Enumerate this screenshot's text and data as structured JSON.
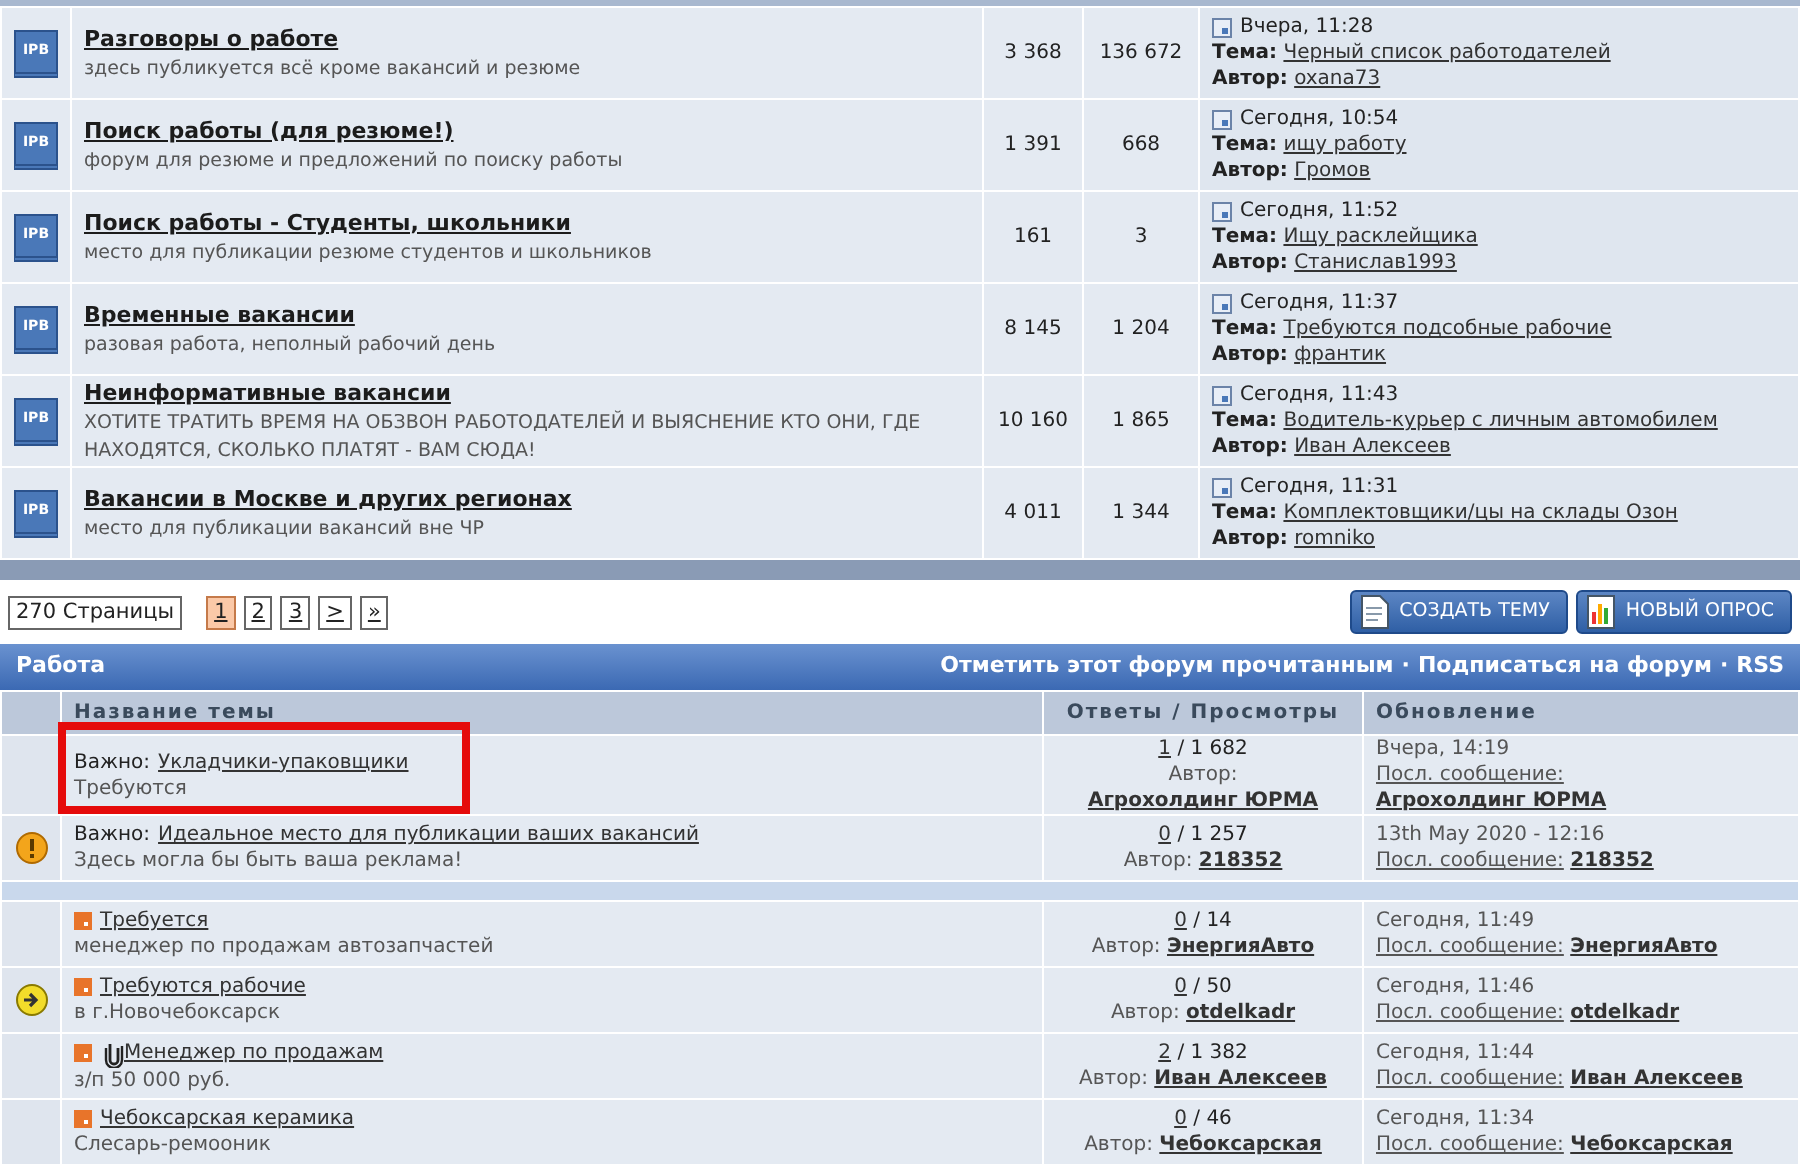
{
  "forums": [
    {
      "icon_text": "IPB",
      "title": "Разговоры о работе",
      "description": "здесь публикуется всё кроме вакансий и резюме",
      "topics": "3 368",
      "posts": "136 672",
      "last_date": "Вчера, 11:28",
      "topic_label": "Тема:",
      "last_topic": "Черный список работодателей",
      "author_label": "Автор:",
      "last_author": "oxana73"
    },
    {
      "icon_text": "IPB",
      "title": "Поиск работы (для резюме!)",
      "description": "форум для резюме и предложений по поиску работы",
      "topics": "1 391",
      "posts": "668",
      "last_date": "Сегодня, 10:54",
      "topic_label": "Тема:",
      "last_topic": "ищу работу",
      "author_label": "Автор:",
      "last_author": "Громов"
    },
    {
      "icon_text": "IPB",
      "title": "Поиск работы - Студенты, школьники",
      "description": "место для публикации резюме студентов и школьников",
      "topics": "161",
      "posts": "3",
      "last_date": "Сегодня, 11:52",
      "topic_label": "Тема:",
      "last_topic": "Ищу расклейщика",
      "author_label": "Автор:",
      "last_author": "Станислав1993"
    },
    {
      "icon_text": "IPB",
      "title": "Временные вакансии",
      "description": "разовая работа, неполный рабочий день",
      "topics": "8 145",
      "posts": "1 204",
      "last_date": "Сегодня, 11:37",
      "topic_label": "Тема:",
      "last_topic": "Требуются подсобные рабочие",
      "author_label": "Автор:",
      "last_author": "франтик"
    },
    {
      "icon_text": "IPB",
      "title": "Неинформативные вакансии",
      "description": "ХОТИТЕ ТРАТИТЬ ВРЕМЯ НА ОБЗВОН РАБОТОДАТЕЛЕЙ И ВЫЯСНЕНИЕ КТО ОНИ, ГДЕ НАХОДЯТСЯ, СКОЛЬКО ПЛАТЯТ - ВАМ СЮДА!",
      "topics": "10 160",
      "posts": "1 865",
      "last_date": "Сегодня, 11:43",
      "topic_label": "Тема:",
      "last_topic": "Водитель-курьер с личным автомобилем",
      "author_label": "Автор:",
      "last_author": "Иван Алексеев"
    },
    {
      "icon_text": "IPB",
      "title": "Вакансии в Москве и других регионах",
      "description": "место для публикации вакансий вне ЧР",
      "topics": "4 011",
      "posts": "1 344",
      "last_date": "Сегодня, 11:31",
      "topic_label": "Тема:",
      "last_topic": "Комплектовщики/цы на склады Озон",
      "author_label": "Автор:",
      "last_author": "romniko"
    }
  ],
  "pagination": {
    "pages_label": "270 Страницы",
    "pages": [
      {
        "label": "1",
        "selected": true
      },
      {
        "label": "2",
        "selected": false
      },
      {
        "label": "3",
        "selected": false
      }
    ],
    "next": ">",
    "last": "»"
  },
  "buttons": [
    {
      "kind": "new-topic",
      "label": "СОЗДАТЬ ТЕМУ"
    },
    {
      "kind": "poll",
      "label": "НОВЫЙ ОПРОС"
    }
  ],
  "topic_table": {
    "title": "Работа",
    "actions": [
      "Отметить этот форум прочитанным",
      "Подписаться на форум",
      "RSS"
    ],
    "separator": "·",
    "columns": [
      "Название темы",
      "Ответы / Просмотры",
      "Обновление"
    ],
    "topics": [
      {
        "kind": "pinned",
        "warning": false,
        "new_posts": false,
        "highlighted": true,
        "attachment": false,
        "prefix": "Важно:",
        "title": "Укладчики-упаковщики",
        "description": "Требуются",
        "replies": "1",
        "views": "/ 1 682",
        "author_label": "Автор:",
        "author": "Агрохолдинг ЮРМА",
        "date": "Вчера, 14:19",
        "last_label": "Посл. сообщение:",
        "last_author": "Агрохолдинг ЮРМА"
      },
      {
        "kind": "pinned",
        "warning": true,
        "new_posts": false,
        "highlighted": false,
        "attachment": false,
        "prefix": "Важно:",
        "title": "Идеальное место для публикации ваших вакансий",
        "description": "Здесь могла бы быть ваша реклама!",
        "replies": "0",
        "views": "/ 1 257",
        "author_label": "Автор:",
        "author": "218352",
        "date": "13th May 2020 - 12:16",
        "last_label": "Посл. сообщение:",
        "last_author": "218352"
      },
      {
        "kind": "normal",
        "warning": false,
        "new_posts": false,
        "highlighted": false,
        "attachment": false,
        "title": "Требуется",
        "description": "менеджер по продажам автозапчастей",
        "replies": "0",
        "views": "/ 14",
        "author_label": "Автор:",
        "author": "ЭнергияАвто",
        "date": "Сегодня, 11:49",
        "last_label": "Посл. сообщение:",
        "last_author": "ЭнергияАвто"
      },
      {
        "kind": "normal",
        "warning": false,
        "new_posts": true,
        "highlighted": false,
        "attachment": false,
        "title": "Требуются рабочие",
        "description": "в г.Новочебоксарск",
        "replies": "0",
        "views": "/ 50",
        "author_label": "Автор:",
        "author": "otdelkadr",
        "date": "Сегодня, 11:46",
        "last_label": "Посл. сообщение:",
        "last_author": "otdelkadr"
      },
      {
        "kind": "normal",
        "warning": false,
        "new_posts": false,
        "highlighted": false,
        "attachment": true,
        "title": "Менеджер по продажам",
        "description": "з/п 50 000 руб.",
        "replies": "2",
        "views": "/ 1 382",
        "author_label": "Автор:",
        "author": "Иван Алексеев",
        "date": "Сегодня, 11:44",
        "last_label": "Посл. сообщение:",
        "last_author": "Иван Алексеев"
      },
      {
        "kind": "normal",
        "warning": false,
        "new_posts": false,
        "highlighted": false,
        "attachment": false,
        "title": "Чебоксарская керамика",
        "description": "Слесарь-ремооник",
        "replies": "0",
        "views": "/ 46",
        "author_label": "Автор:",
        "author": "Чебоксарская",
        "date": "Сегодня, 11:34",
        "last_label": "Посл. сообщение:",
        "last_author": "Чебоксарская"
      }
    ]
  }
}
